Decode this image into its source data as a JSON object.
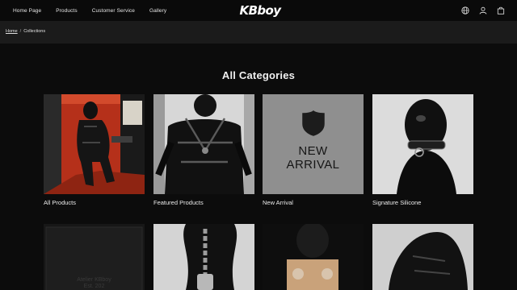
{
  "nav": {
    "items": [
      "Home Page",
      "Products",
      "Customer Service",
      "Gallery"
    ]
  },
  "brand": {
    "logo_text": "KBboy"
  },
  "header_icons": [
    "globe-icon",
    "user-icon",
    "bag-icon"
  ],
  "breadcrumb": {
    "home": "Home",
    "separator": "/",
    "current": "Collections"
  },
  "page": {
    "title": "All Categories"
  },
  "categories": [
    {
      "label": "All Products"
    },
    {
      "label": "Featured Products"
    },
    {
      "label": "New Arrival",
      "tile_line1": "NEW",
      "tile_line2": "ARRIVAL"
    },
    {
      "label": "Signature Silicone"
    }
  ],
  "row2_box_text": {
    "line1": "Atelier KBboy",
    "line2": "Est. 202"
  },
  "colors": {
    "background": "#0c0c0c",
    "crumb_bar": "#1b1b1b",
    "new_arrival_tile": "#8f8f8f",
    "accent_red": "#c8361e"
  }
}
